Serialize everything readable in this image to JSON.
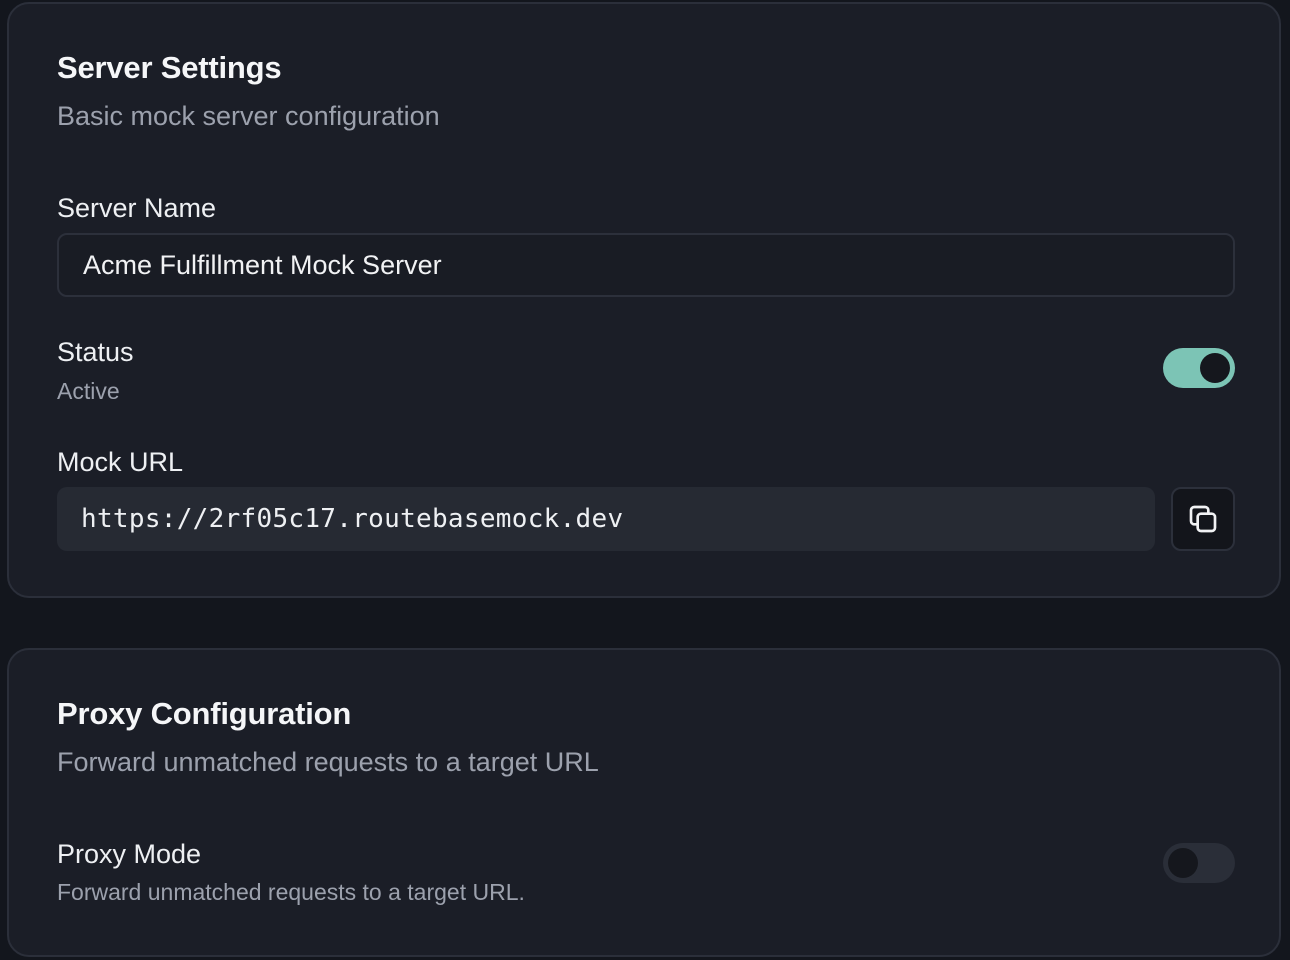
{
  "server_settings": {
    "title": "Server Settings",
    "description": "Basic mock server configuration",
    "server_name": {
      "label": "Server Name",
      "value": "Acme Fulfillment Mock Server"
    },
    "status": {
      "label": "Status",
      "value": "Active",
      "enabled": true
    },
    "mock_url": {
      "label": "Mock URL",
      "value": "https://2rf05c17.routebasemock.dev",
      "copy_icon": "copy-icon"
    }
  },
  "proxy_configuration": {
    "title": "Proxy Configuration",
    "description": "Forward unmatched requests to a target URL",
    "proxy_mode": {
      "label": "Proxy Mode",
      "description": "Forward unmatched requests to a target URL.",
      "enabled": false
    }
  },
  "colors": {
    "page_background": "#13161d",
    "card_background": "#1b1e27",
    "toggle_on": "#7cc4b5",
    "toggle_off": "#2a2e38"
  }
}
